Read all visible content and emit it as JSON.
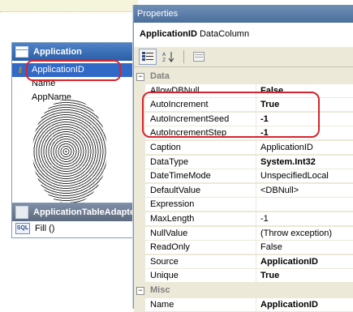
{
  "designer": {
    "table_title": "Application",
    "columns": [
      "ApplicationID",
      "Name",
      "AppName"
    ],
    "adapter_title": "ApplicationTableAdapter",
    "adapter_methods": [
      {
        "icon_text": "SQL",
        "label": "Fill ()"
      }
    ]
  },
  "properties": {
    "window_title": "Properties",
    "object_name": "ApplicationID",
    "object_type": "DataColumn",
    "toolbar": [
      "categorized-icon",
      "alphabetical-icon",
      "property-pages-icon"
    ],
    "categories": [
      {
        "label": "Data",
        "expander": "−",
        "rows": [
          {
            "name": "AllowDBNull",
            "value": "False",
            "bold": true
          },
          {
            "name": "AutoIncrement",
            "value": "True",
            "bold": true
          },
          {
            "name": "AutoIncrementSeed",
            "value": "-1",
            "bold": true
          },
          {
            "name": "AutoIncrementStep",
            "value": "-1",
            "bold": true
          },
          {
            "name": "Caption",
            "value": "ApplicationID",
            "bold": false
          },
          {
            "name": "DataType",
            "value": "System.Int32",
            "bold": true
          },
          {
            "name": "DateTimeMode",
            "value": "UnspecifiedLocal",
            "bold": false
          },
          {
            "name": "DefaultValue",
            "value": "<DBNull>",
            "bold": false
          },
          {
            "name": "Expression",
            "value": "",
            "bold": false
          },
          {
            "name": "MaxLength",
            "value": "-1",
            "bold": false
          },
          {
            "name": "NullValue",
            "value": "(Throw exception)",
            "bold": false
          },
          {
            "name": "ReadOnly",
            "value": "False",
            "bold": false
          },
          {
            "name": "Source",
            "value": "ApplicationID",
            "bold": true
          },
          {
            "name": "Unique",
            "value": "True",
            "bold": true
          }
        ]
      },
      {
        "label": "Misc",
        "expander": "−",
        "rows": [
          {
            "name": "Name",
            "value": "ApplicationID",
            "bold": true
          }
        ]
      }
    ]
  },
  "colors": {
    "accent": "#3169c6",
    "highlight": "#d9232d"
  }
}
